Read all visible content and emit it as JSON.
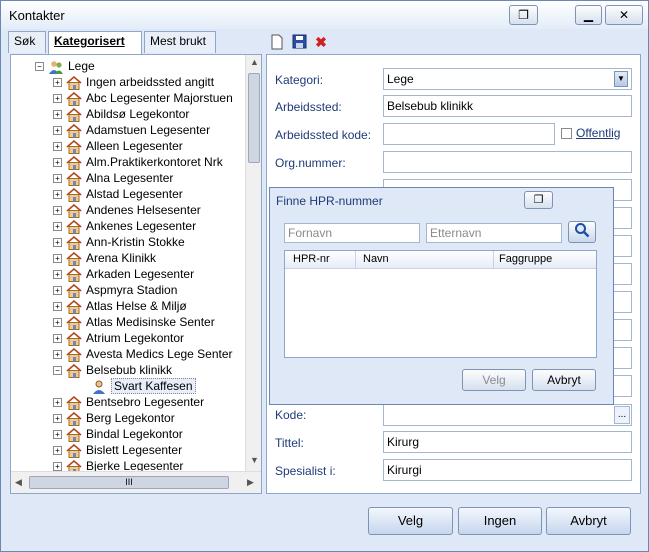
{
  "window": {
    "title": "Kontakter"
  },
  "tabs": [
    {
      "label": "Søk"
    },
    {
      "label": "Kategorisert"
    },
    {
      "label": "Mest brukt"
    }
  ],
  "tree": {
    "root": "Lege",
    "items": [
      "Ingen arbeidssted angitt",
      "Abc Legesenter Majorstuen",
      "Abildsø Legekontor",
      "Adamstuen Legesenter",
      "Alleen Legesenter",
      "Alm.Praktikerkontoret Nrk",
      "Alna Legesenter",
      "Alstad Legesenter",
      "Andenes Helsesenter",
      "Ankenes Legesenter",
      "Ann-Kristin Stokke",
      "Arena Klinikk",
      "Arkaden Legesenter",
      "Aspmyra Stadion",
      "Atlas Helse & Miljø",
      "Atlas Medisinske Senter",
      "Atrium Legekontor",
      "Avesta Medics Lege Senter",
      "Belsebub klinikk"
    ],
    "child": "Svart Kaffesen",
    "items_after": [
      "Bentsebro Legesenter",
      "Berg Legekontor",
      "Bindal Legekontor",
      "Bislett Legesenter",
      "Bjerke Legesenter"
    ],
    "hscroll_grip": "III"
  },
  "form": {
    "kategori_label": "Kategori:",
    "kategori_value": "Lege",
    "arbeidssted_label": "Arbeidssted:",
    "arbeidssted_value": "Belsebub klinikk",
    "arbeidsstedkode_label": "Arbeidssted kode:",
    "arbeidsstedkode_value": "",
    "offentlig_label": "Offentlig",
    "orgnummer_label": "Org.nummer:",
    "orgnummer_value": "",
    "kode_label": "Kode:",
    "kode_button": "...",
    "tittel_label": "Tittel:",
    "tittel_value": "Kirurg",
    "spesialist_label": "Spesialist i:",
    "spesialist_value": "Kirurgi"
  },
  "dialog": {
    "title": "Finne HPR-nummer",
    "fornavn_placeholder": "Fornavn",
    "etternavn_placeholder": "Etternavn",
    "columns": [
      "HPR-nr",
      "Navn",
      "Faggruppe"
    ],
    "velg_label": "Velg",
    "avbryt_label": "Avbryt"
  },
  "buttons": {
    "velg": "Velg",
    "ingen": "Ingen",
    "avbryt": "Avbryt"
  },
  "icons": [
    "new-document-icon",
    "save-icon",
    "delete-icon",
    "search-icon",
    "house-icon",
    "person-icon",
    "restore-icon",
    "minimize-icon",
    "close-icon"
  ]
}
